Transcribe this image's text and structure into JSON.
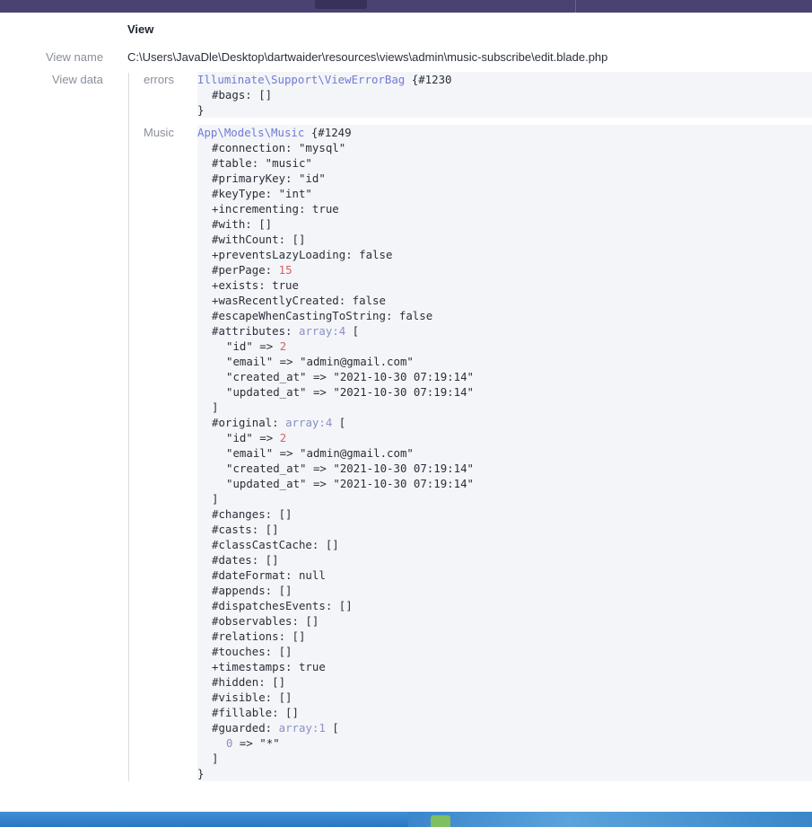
{
  "section_title": "View",
  "view_name_label": "View name",
  "view_name_value": "C:\\Users\\JavaDle\\Desktop\\dartwaider\\resources\\views\\admin\\music-subscribe\\edit.blade.php",
  "view_data_label": "View data",
  "errors": {
    "label": "errors",
    "lines": [
      {
        "indent": 0,
        "parts": [
          {
            "t": "Illuminate\\Support\\ViewErrorBag",
            "c": "cls"
          },
          {
            "t": " {",
            "c": "kw"
          },
          {
            "t": "#1230",
            "c": "kw"
          }
        ]
      },
      {
        "indent": 1,
        "parts": [
          {
            "t": "#bags: []",
            "c": "kw"
          }
        ]
      },
      {
        "indent": 0,
        "parts": [
          {
            "t": "}",
            "c": "kw"
          }
        ]
      }
    ]
  },
  "music": {
    "label": "Music",
    "lines": [
      {
        "indent": 0,
        "parts": [
          {
            "t": "App\\Models\\Music",
            "c": "cls"
          },
          {
            "t": " {#1249",
            "c": "kw"
          }
        ]
      },
      {
        "indent": 1,
        "parts": [
          {
            "t": "#connection: \"mysql\"",
            "c": "kw"
          }
        ]
      },
      {
        "indent": 1,
        "parts": [
          {
            "t": "#table: \"music\"",
            "c": "kw"
          }
        ]
      },
      {
        "indent": 1,
        "parts": [
          {
            "t": "#primaryKey: \"id\"",
            "c": "kw"
          }
        ]
      },
      {
        "indent": 1,
        "parts": [
          {
            "t": "#keyType: \"int\"",
            "c": "kw"
          }
        ]
      },
      {
        "indent": 1,
        "parts": [
          {
            "t": "+incrementing: true",
            "c": "kw"
          }
        ]
      },
      {
        "indent": 1,
        "parts": [
          {
            "t": "#with: []",
            "c": "kw"
          }
        ]
      },
      {
        "indent": 1,
        "parts": [
          {
            "t": "#withCount: []",
            "c": "kw"
          }
        ]
      },
      {
        "indent": 1,
        "parts": [
          {
            "t": "+preventsLazyLoading: false",
            "c": "kw"
          }
        ]
      },
      {
        "indent": 1,
        "parts": [
          {
            "t": "#perPage: ",
            "c": "kw"
          },
          {
            "t": "15",
            "c": "num"
          }
        ]
      },
      {
        "indent": 1,
        "parts": [
          {
            "t": "+exists: true",
            "c": "kw"
          }
        ]
      },
      {
        "indent": 1,
        "parts": [
          {
            "t": "+wasRecentlyCreated: false",
            "c": "kw"
          }
        ]
      },
      {
        "indent": 1,
        "parts": [
          {
            "t": "#escapeWhenCastingToString: false",
            "c": "kw"
          }
        ]
      },
      {
        "indent": 1,
        "parts": [
          {
            "t": "#attributes: ",
            "c": "kw"
          },
          {
            "t": "array:4",
            "c": "meta"
          },
          {
            "t": " [",
            "c": "kw"
          }
        ]
      },
      {
        "indent": 2,
        "parts": [
          {
            "t": "\"id\" => ",
            "c": "kw"
          },
          {
            "t": "2",
            "c": "num"
          }
        ]
      },
      {
        "indent": 2,
        "parts": [
          {
            "t": "\"email\" => \"admin@gmail.com\"",
            "c": "kw"
          }
        ]
      },
      {
        "indent": 2,
        "parts": [
          {
            "t": "\"created_at\" => \"2021-10-30 07:19:14\"",
            "c": "kw"
          }
        ]
      },
      {
        "indent": 2,
        "parts": [
          {
            "t": "\"updated_at\" => \"2021-10-30 07:19:14\"",
            "c": "kw"
          }
        ]
      },
      {
        "indent": 1,
        "parts": [
          {
            "t": "]",
            "c": "kw"
          }
        ]
      },
      {
        "indent": 1,
        "parts": [
          {
            "t": "#original: ",
            "c": "kw"
          },
          {
            "t": "array:4",
            "c": "meta"
          },
          {
            "t": " [",
            "c": "kw"
          }
        ]
      },
      {
        "indent": 2,
        "parts": [
          {
            "t": "\"id\" => ",
            "c": "kw"
          },
          {
            "t": "2",
            "c": "num"
          }
        ]
      },
      {
        "indent": 2,
        "parts": [
          {
            "t": "\"email\" => \"admin@gmail.com\"",
            "c": "kw"
          }
        ]
      },
      {
        "indent": 2,
        "parts": [
          {
            "t": "\"created_at\" => \"2021-10-30 07:19:14\"",
            "c": "kw"
          }
        ]
      },
      {
        "indent": 2,
        "parts": [
          {
            "t": "\"updated_at\" => \"2021-10-30 07:19:14\"",
            "c": "kw"
          }
        ]
      },
      {
        "indent": 1,
        "parts": [
          {
            "t": "]",
            "c": "kw"
          }
        ]
      },
      {
        "indent": 1,
        "parts": [
          {
            "t": "#changes: []",
            "c": "kw"
          }
        ]
      },
      {
        "indent": 1,
        "parts": [
          {
            "t": "#casts: []",
            "c": "kw"
          }
        ]
      },
      {
        "indent": 1,
        "parts": [
          {
            "t": "#classCastCache: []",
            "c": "kw"
          }
        ]
      },
      {
        "indent": 1,
        "parts": [
          {
            "t": "#dates: []",
            "c": "kw"
          }
        ]
      },
      {
        "indent": 1,
        "parts": [
          {
            "t": "#dateFormat: null",
            "c": "kw"
          }
        ]
      },
      {
        "indent": 1,
        "parts": [
          {
            "t": "#appends: []",
            "c": "kw"
          }
        ]
      },
      {
        "indent": 1,
        "parts": [
          {
            "t": "#dispatchesEvents: []",
            "c": "kw"
          }
        ]
      },
      {
        "indent": 1,
        "parts": [
          {
            "t": "#observables: []",
            "c": "kw"
          }
        ]
      },
      {
        "indent": 1,
        "parts": [
          {
            "t": "#relations: []",
            "c": "kw"
          }
        ]
      },
      {
        "indent": 1,
        "parts": [
          {
            "t": "#touches: []",
            "c": "kw"
          }
        ]
      },
      {
        "indent": 1,
        "parts": [
          {
            "t": "+timestamps: true",
            "c": "kw"
          }
        ]
      },
      {
        "indent": 1,
        "parts": [
          {
            "t": "#hidden: []",
            "c": "kw"
          }
        ]
      },
      {
        "indent": 1,
        "parts": [
          {
            "t": "#visible: []",
            "c": "kw"
          }
        ]
      },
      {
        "indent": 1,
        "parts": [
          {
            "t": "#fillable: []",
            "c": "kw"
          }
        ]
      },
      {
        "indent": 1,
        "parts": [
          {
            "t": "#guarded: ",
            "c": "kw"
          },
          {
            "t": "array:1",
            "c": "meta"
          },
          {
            "t": " [",
            "c": "kw"
          }
        ]
      },
      {
        "indent": 2,
        "parts": [
          {
            "t": "0",
            "c": "meta"
          },
          {
            "t": " => \"*\"",
            "c": "kw"
          }
        ]
      },
      {
        "indent": 1,
        "parts": [
          {
            "t": "]",
            "c": "kw"
          }
        ]
      },
      {
        "indent": 0,
        "parts": [
          {
            "t": "}",
            "c": "kw"
          }
        ]
      }
    ]
  },
  "colors": {
    "topbar": "#4a4270",
    "class_name": "#6f7ad8",
    "number": "#d86060",
    "dump_bg": "#f4f5f8"
  }
}
